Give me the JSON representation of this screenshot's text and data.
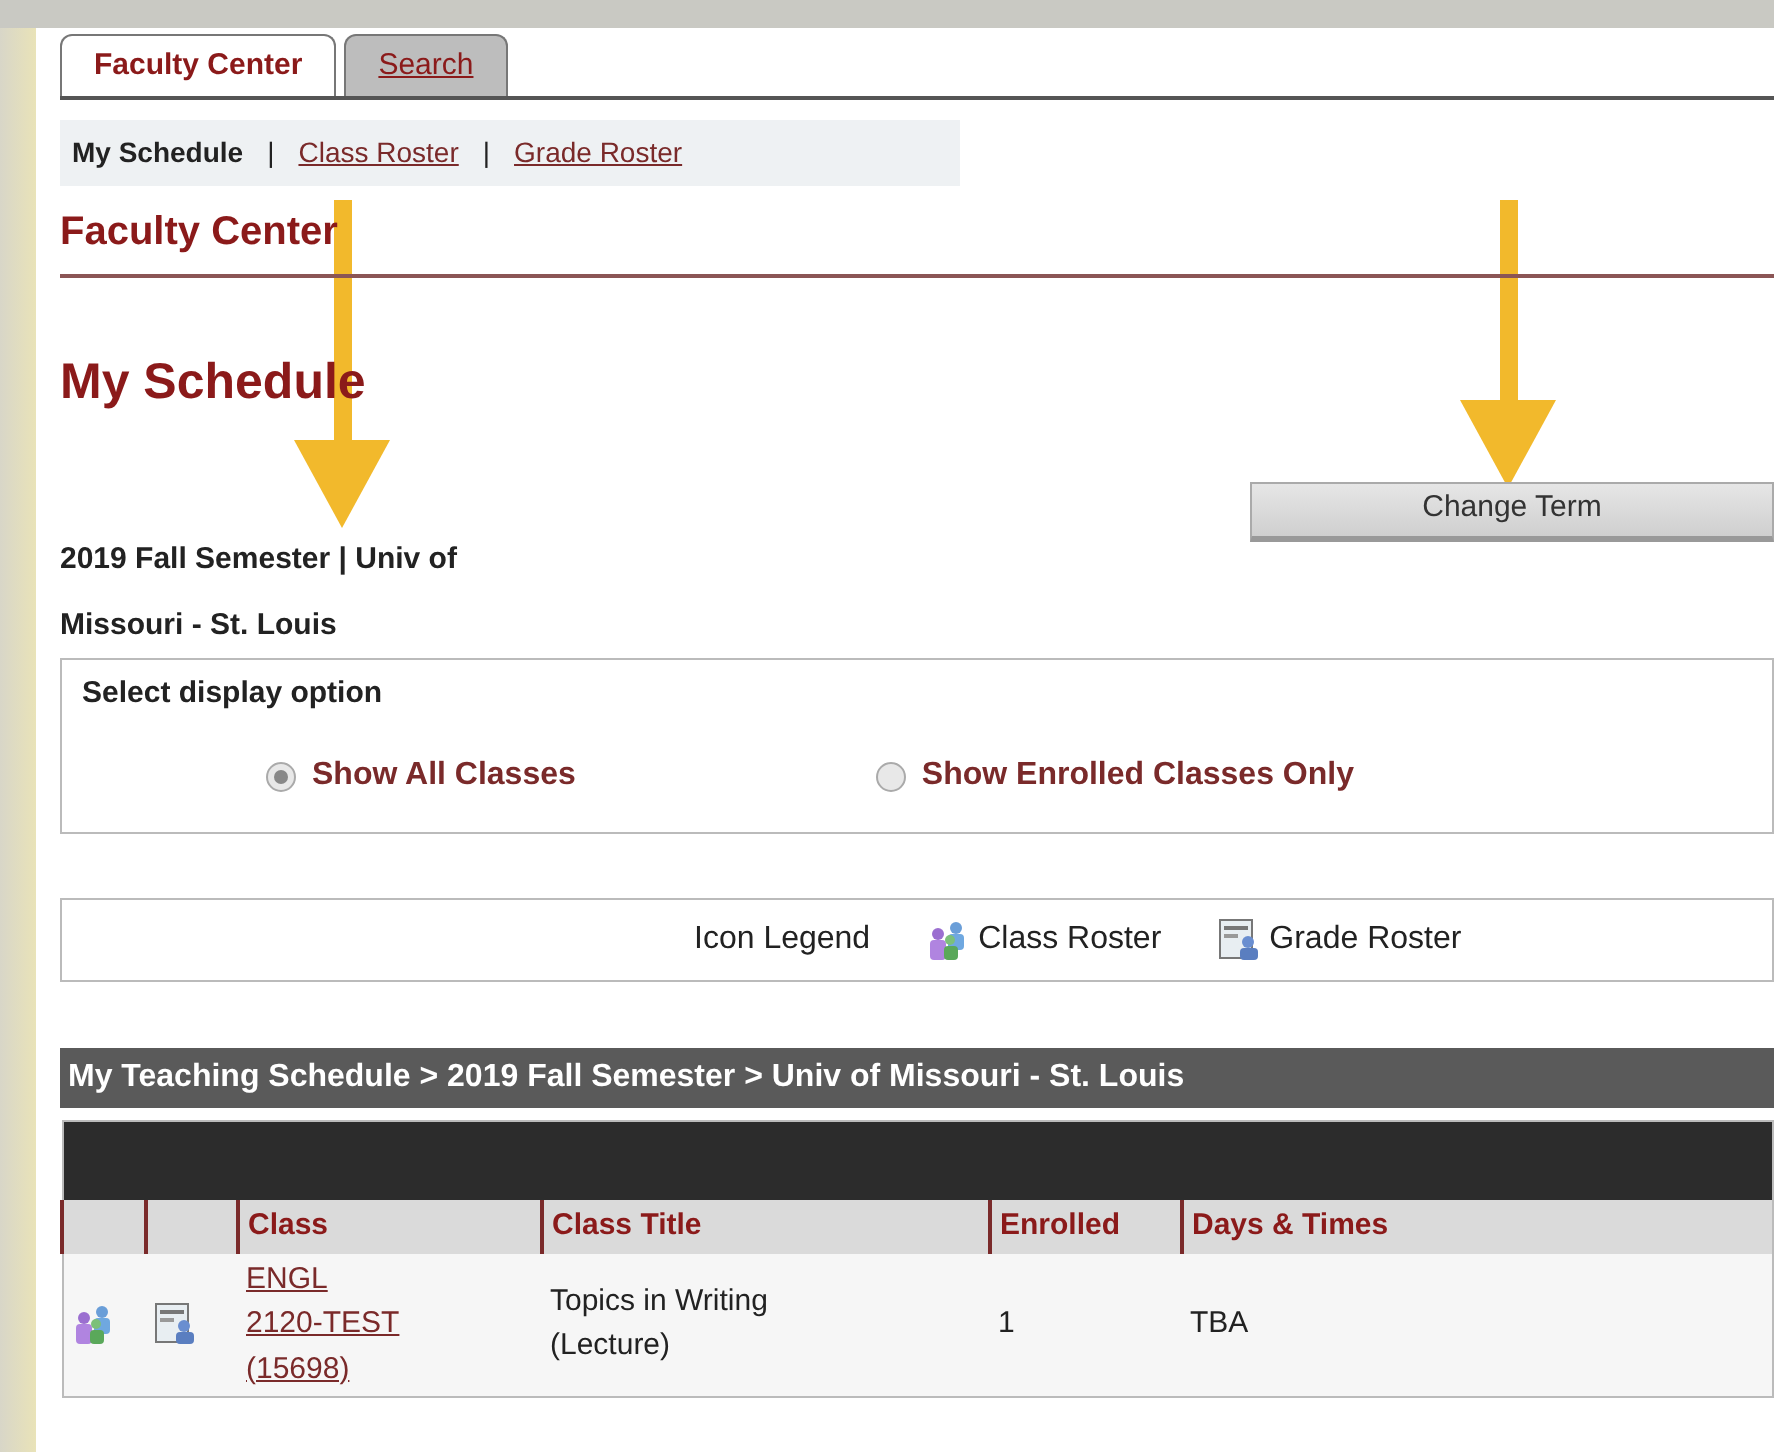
{
  "tabs": [
    {
      "label": "Faculty Center",
      "selected": true
    },
    {
      "label": "Search",
      "selected": false
    }
  ],
  "subnav": [
    {
      "label": "My Schedule",
      "selected": true
    },
    {
      "label": "Class Roster",
      "selected": false
    },
    {
      "label": "Grade Roster",
      "selected": false
    }
  ],
  "subnav_separator": "|",
  "section_title": "Faculty Center",
  "page_title": "My Schedule",
  "term": "2019 Fall Semester | Univ of Missouri - St. Louis",
  "change_term_button": "Change Term",
  "display_option": {
    "label": "Select display option",
    "options": [
      {
        "label": "Show All Classes",
        "selected": true
      },
      {
        "label": "Show Enrolled Classes Only",
        "selected": false
      }
    ]
  },
  "icon_legend": {
    "label": "Icon Legend",
    "items": [
      {
        "kind": "class_roster",
        "label": "Class Roster"
      },
      {
        "kind": "grade_roster",
        "label": "Grade Roster"
      }
    ]
  },
  "schedule": {
    "title": "My Teaching Schedule > 2019 Fall Semester > Univ of Missouri - St. Louis",
    "columns": [
      "Class",
      "Class Title",
      "Enrolled",
      "Days & Times"
    ],
    "rows": [
      {
        "class": "ENGL 2120-TEST (15698)",
        "class_title": "Topics in Writing (Lecture)",
        "enrolled": "1",
        "days_times": "TBA"
      }
    ]
  },
  "annotations": [
    {
      "kind": "arrow"
    },
    {
      "kind": "arrow"
    }
  ]
}
